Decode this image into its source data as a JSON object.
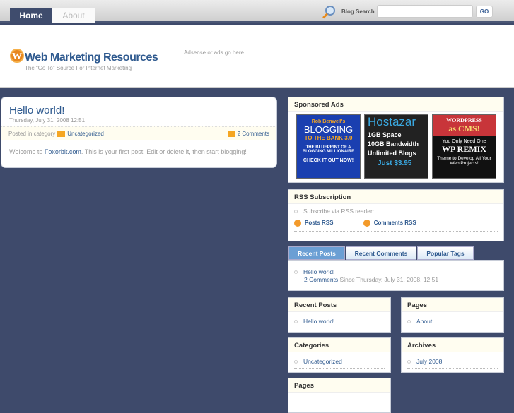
{
  "nav": {
    "home": "Home",
    "about": "About"
  },
  "search": {
    "label": "Blog Search",
    "value": "",
    "go": "GO"
  },
  "header": {
    "title": "Web Marketing Resources",
    "tagline": "The “Go To” Source For Internet Marketing",
    "adsense": "Adsense or ads go here"
  },
  "post": {
    "title": "Hello world!",
    "date": "Thursday, July 31, 2008 12:51",
    "posted_in": "Posted in category",
    "category": "Uncategorized",
    "comments": "2 Comments",
    "body_pre": "Welcome to ",
    "body_link": "Foxorbit.com",
    "body_post": ". This is your first post. Edit or delete it, then start blogging!"
  },
  "sponsored": {
    "title": "Sponsored Ads",
    "ads": [
      {
        "l1": "Rob Benwell's",
        "l2": "BLOGGING",
        "l3": "TO THE BANK 3.0",
        "l4": "THE BLUEPRINT OF A BLOGGING MILLIONAIRE",
        "l5": "CHECK IT OUT NOW!"
      },
      {
        "l1": "Hostazar",
        "l2": "1GB Space",
        "l3": "10GB Bandwidth",
        "l4": "Unlimited Blogs",
        "l5": "Just $3.95"
      },
      {
        "l1": "WORDPRESS",
        "l2": "as CMS!",
        "l3": "You Only Need One",
        "l4": "WP REMIX",
        "l5": "Theme to Develop All Your Web Projects!"
      }
    ]
  },
  "rss": {
    "title": "RSS Subscription",
    "subscribe": "Subscribe via RSS reader:",
    "posts": "Posts RSS",
    "comments": "Comments RSS"
  },
  "tabs": {
    "items": [
      "Recent Posts",
      "Recent Comments",
      "Popular Tags"
    ],
    "post_title": "Hello world!",
    "comments": "2 Comments",
    "since": " Since Thursday, July 31, 2008, 12:51"
  },
  "widgets": {
    "recent": {
      "title": "Recent Posts",
      "item": "Hello world!"
    },
    "pages": {
      "title": "Pages",
      "item": "About"
    },
    "categories": {
      "title": "Categories",
      "item": "Uncategorized"
    },
    "archives": {
      "title": "Archives",
      "item": "July 2008"
    },
    "pages2": {
      "title": "Pages"
    }
  }
}
